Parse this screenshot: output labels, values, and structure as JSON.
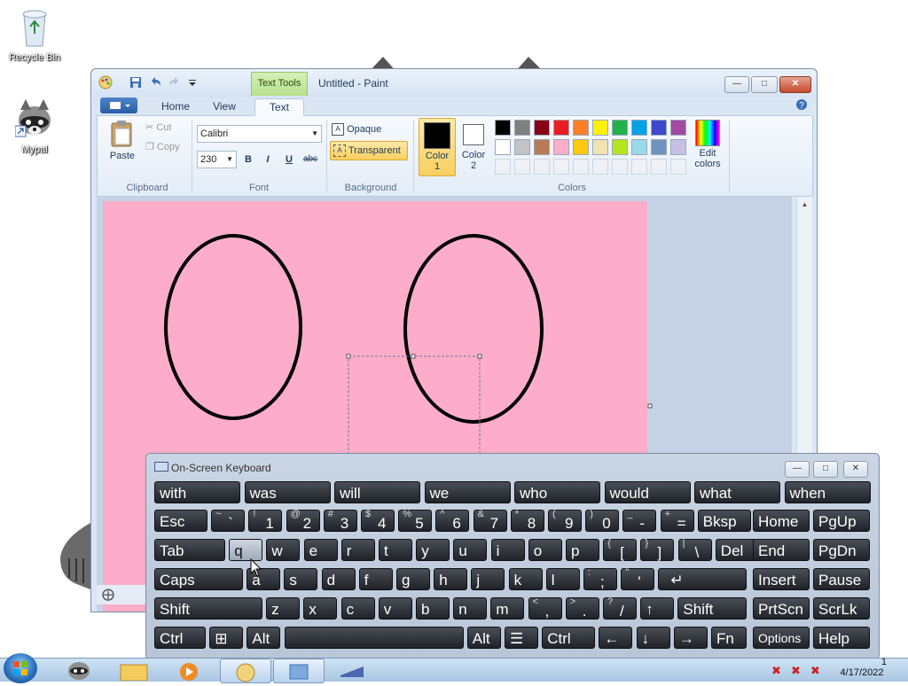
{
  "desktop": {
    "icons": [
      {
        "label": "Recycle Bin",
        "icon": "recycle-bin-icon"
      },
      {
        "label": "Mypal",
        "icon": "raccoon-icon"
      }
    ]
  },
  "paint": {
    "title": "Untitled - Paint",
    "context_tab": "Text Tools",
    "tabs": [
      "Home",
      "View",
      "Text"
    ],
    "active_tab": "Text",
    "clipboard": {
      "paste": "Paste",
      "cut": "Cut",
      "copy": "Copy",
      "label": "Clipboard"
    },
    "font": {
      "family": "Calibri",
      "size": "230",
      "bold": "B",
      "italic": "I",
      "underline": "U",
      "strike": "abc",
      "label": "Font"
    },
    "background": {
      "opaque": "Opaque",
      "transparent": "Transparent",
      "label": "Background"
    },
    "colors": {
      "color1_label_a": "Color",
      "color1_label_b": "1",
      "color2_label_a": "Color",
      "color2_label_b": "2",
      "edit_a": "Edit",
      "edit_b": "colors",
      "label": "Colors",
      "color1": "#000000",
      "color2": "#ffffff",
      "row1": [
        "#000000",
        "#7f7f7f",
        "#880015",
        "#ed1c24",
        "#ff7f27",
        "#fff200",
        "#22b14c",
        "#00a2e8",
        "#3f48cc",
        "#a349a4"
      ],
      "row2": [
        "#ffffff",
        "#c3c3c3",
        "#b97a57",
        "#ffaec9",
        "#ffc90e",
        "#efe4b0",
        "#b5e61d",
        "#99d9ea",
        "#7092be",
        "#c8bfe7"
      ]
    },
    "canvas_color": "#fdadc9"
  },
  "osk": {
    "title": "On-Screen Keyboard",
    "predictions": [
      "with",
      "was",
      "will",
      "we",
      "who",
      "would",
      "what",
      "when"
    ],
    "row1": [
      {
        "label": "Esc"
      },
      {
        "top": "~",
        "main": "`"
      },
      {
        "top": "!",
        "main": "1"
      },
      {
        "top": "@",
        "main": "2"
      },
      {
        "top": "#",
        "main": "3"
      },
      {
        "top": "$",
        "main": "4"
      },
      {
        "top": "%",
        "main": "5"
      },
      {
        "top": "^",
        "main": "6"
      },
      {
        "top": "&",
        "main": "7"
      },
      {
        "top": "*",
        "main": "8"
      },
      {
        "top": "(",
        "main": "9"
      },
      {
        "top": ")",
        "main": "0"
      },
      {
        "top": "_",
        "main": "-"
      },
      {
        "top": "+",
        "main": "="
      },
      {
        "label": "Bksp"
      }
    ],
    "row2": [
      "Tab",
      "q",
      "w",
      "e",
      "r",
      "t",
      "y",
      "u",
      "i",
      "o",
      "p",
      "[",
      "]",
      "\\",
      "Del"
    ],
    "row2_top": {
      "11": "{",
      "12": "}",
      "13": "|"
    },
    "row3": [
      "Caps",
      "a",
      "s",
      "d",
      "f",
      "g",
      "h",
      "j",
      "k",
      "l",
      ";",
      "'",
      "Enter"
    ],
    "row3_top": {
      "10": ":",
      "11": "\""
    },
    "row4": [
      "Shift",
      "z",
      "x",
      "c",
      "v",
      "b",
      "n",
      "m",
      ",",
      ".",
      "/",
      "↑",
      "Shift"
    ],
    "row4_top": {
      "8": "<",
      "9": ">",
      "10": "?"
    },
    "row5": [
      "Ctrl",
      "⊞",
      "Alt",
      "",
      "Alt",
      "☰",
      "Ctrl",
      "←",
      "↓",
      "→",
      "Fn"
    ],
    "nav": {
      "home": "Home",
      "pgup": "PgUp",
      "end": "End",
      "pgdn": "PgDn",
      "insert": "Insert",
      "pause": "Pause",
      "prtscn": "PrtScn",
      "scrlk": "ScrLk",
      "options": "Options",
      "help": "Help"
    }
  },
  "taskbar": {
    "date": "4/17/2022",
    "time_partial": "1"
  }
}
